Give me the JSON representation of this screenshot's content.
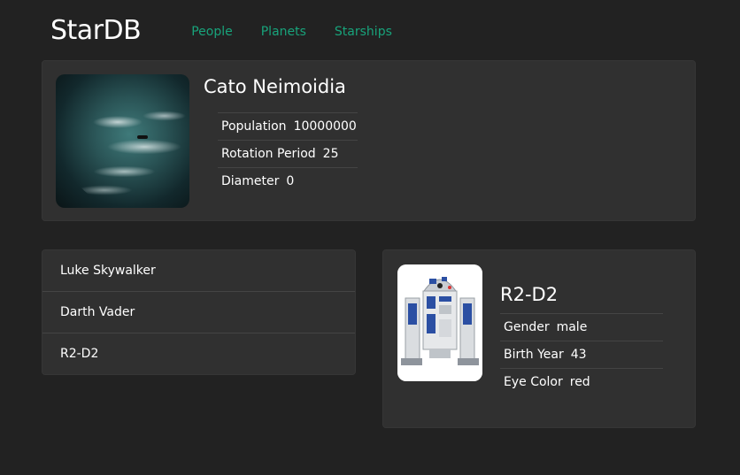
{
  "header": {
    "brand": "StarDB",
    "nav": [
      "People",
      "Planets",
      "Starships"
    ]
  },
  "planet": {
    "name": "Cato Neimoidia",
    "image": "planet-image",
    "details": [
      {
        "label": "Population",
        "value": "10000000"
      },
      {
        "label": "Rotation Period",
        "value": "25"
      },
      {
        "label": "Diameter",
        "value": "0"
      }
    ]
  },
  "people_list": [
    "Luke Skywalker",
    "Darth Vader",
    "R2-D2"
  ],
  "person": {
    "name": "R2-D2",
    "image": "r2d2-image",
    "details": [
      {
        "label": "Gender",
        "value": "male"
      },
      {
        "label": "Birth Year",
        "value": "43"
      },
      {
        "label": "Eye Color",
        "value": "red"
      }
    ]
  },
  "colors": {
    "background": "#222222",
    "panel": "#303030",
    "nav_link": "#18a37b"
  }
}
